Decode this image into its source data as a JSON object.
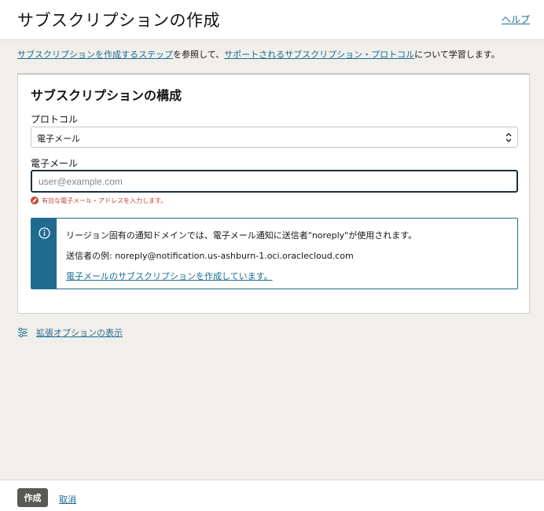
{
  "header": {
    "title": "サブスクリプションの作成",
    "help_label": "ヘルプ"
  },
  "intro": {
    "link1": "サブスクリプションを作成するステップ",
    "text1": "を参照して、",
    "link2": "サポートされるサブスクリプション・プロトコル",
    "text2": "について学習します。"
  },
  "form": {
    "section_title": "サブスクリプションの構成",
    "protocol_label": "プロトコル",
    "protocol_value": "電子メール",
    "email_label": "電子メール",
    "email_value": "",
    "email_placeholder": "user@example.com",
    "error_message": "有効な電子メール・アドレスを入力します。"
  },
  "info": {
    "line1": "リージョン固有の通知ドメインでは、電子メール通知に送信者\"noreply\"が使用されます。",
    "line2": "送信者の例: noreply@notification.us-ashburn-1.oci.oraclecloud.com",
    "link": "電子メールのサブスクリプションを作成しています。",
    "icon": "info-icon"
  },
  "advanced": {
    "label": "拡張オプションの表示",
    "icon": "sliders-icon"
  },
  "footer": {
    "create_label": "作成",
    "cancel_label": "取消"
  },
  "colors": {
    "link": "#1e6b8f",
    "error": "#c74634",
    "button": "#5a5855",
    "background": "#f1efeb"
  }
}
